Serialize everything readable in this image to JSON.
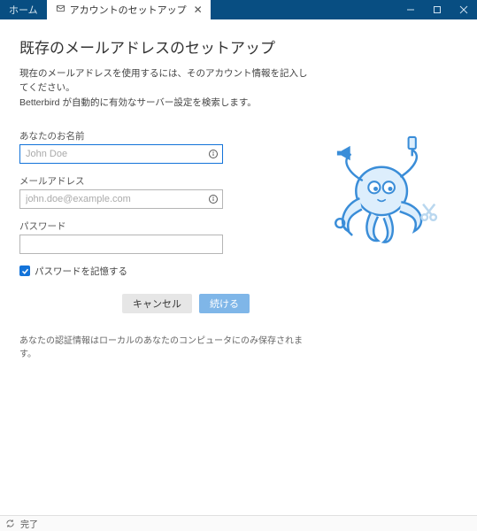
{
  "titlebar": {
    "tab_home": "ホーム",
    "tab_setup": "アカウントのセットアップ"
  },
  "heading": "既存のメールアドレスのセットアップ",
  "intro_line1": "現在のメールアドレスを使用するには、そのアカウント情報を記入してください。",
  "intro_line2": "Betterbird が自動的に有効なサーバー設定を検索します。",
  "labels": {
    "name": "あなたのお名前",
    "email": "メールアドレス",
    "password": "パスワード"
  },
  "placeholders": {
    "name": "John Doe",
    "email": "john.doe@example.com"
  },
  "remember_pw": "パスワードを記憶する",
  "buttons": {
    "cancel": "キャンセル",
    "continue": "続ける"
  },
  "footnote": "あなたの認証情報はローカルのあなたのコンピュータにのみ保存されます。",
  "status": "完了"
}
